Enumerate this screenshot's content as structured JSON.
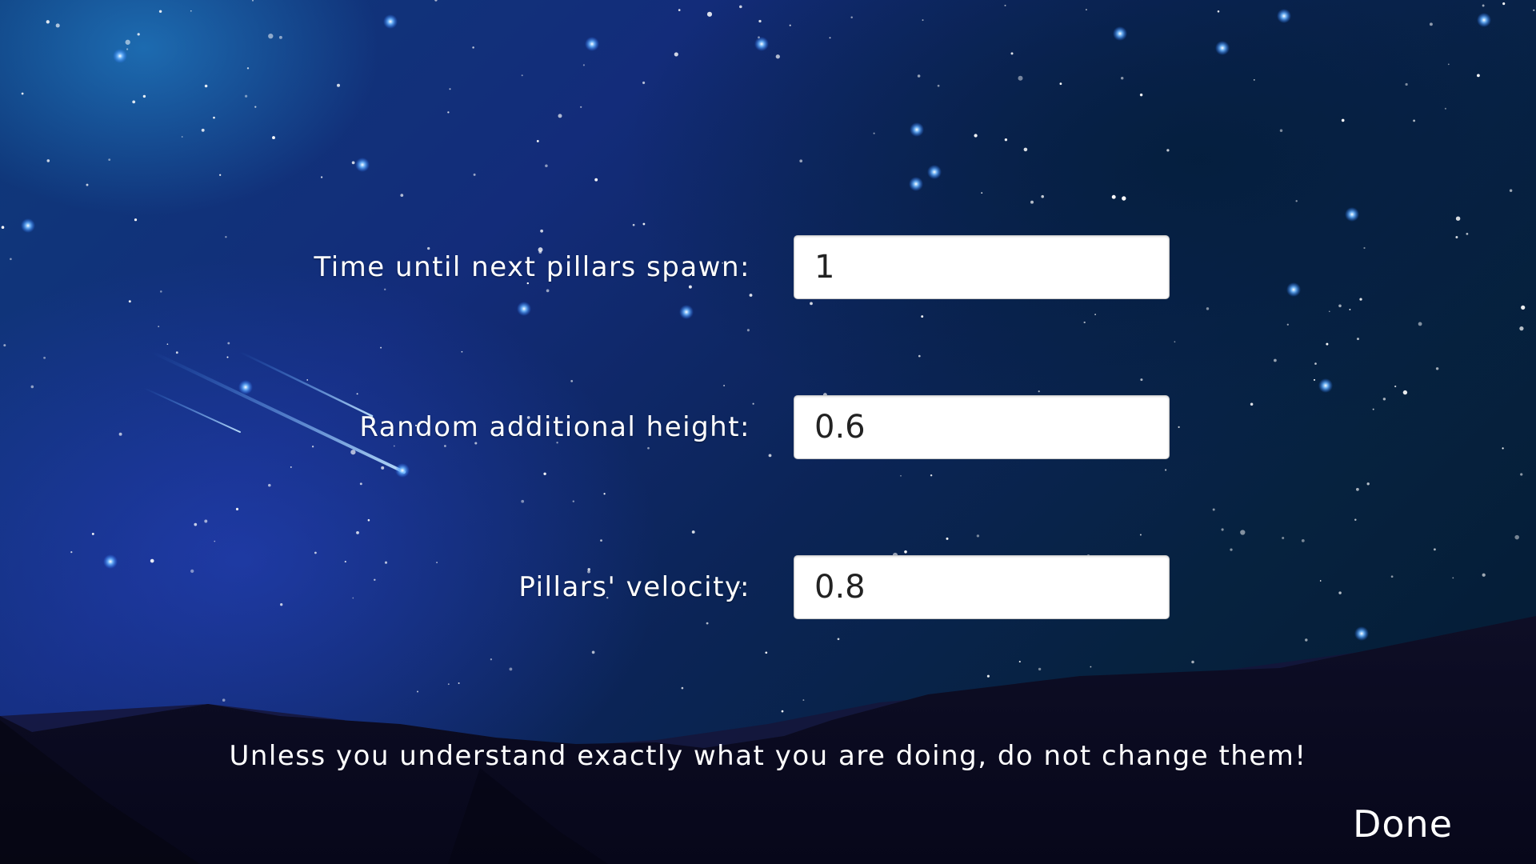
{
  "settings": {
    "fields": [
      {
        "label": "Time until next pillars spawn:",
        "value": "1"
      },
      {
        "label": "Random additional height:",
        "value": "0.6"
      },
      {
        "label": "Pillars' velocity:",
        "value": "0.8"
      }
    ],
    "warning": "Unless you understand exactly what you are doing, do not change them!",
    "done_label": "Done"
  },
  "theme": {
    "background": "night-sky-with-stars",
    "text_color": "#ffffff",
    "input_background": "#ffffff",
    "input_text_color": "#222222",
    "mountain_color": "#0a0a1e"
  }
}
